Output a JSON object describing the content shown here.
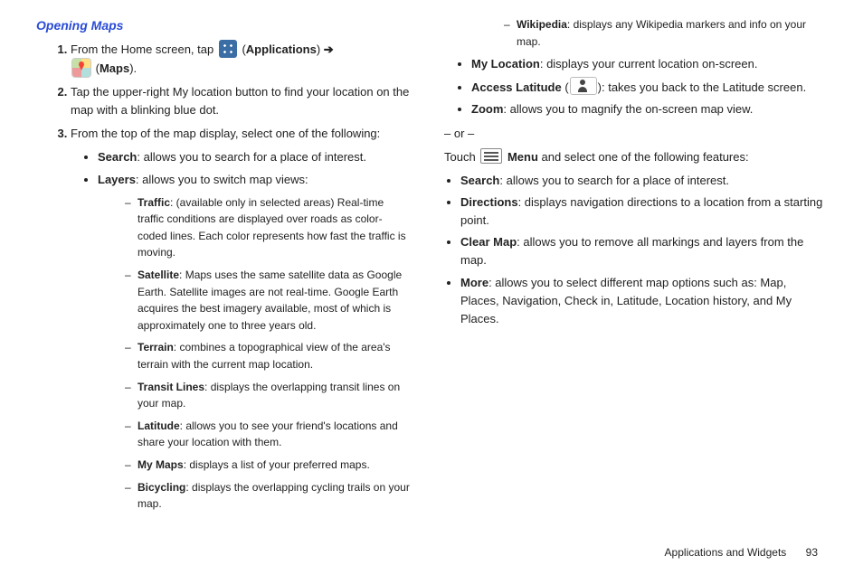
{
  "section_title": "Opening Maps",
  "step1": {
    "pre": "From the Home screen, tap ",
    "apps_label": "Applications",
    "arrow": "➔",
    "maps_label": "Maps",
    "end": "."
  },
  "step2": "Tap the upper-right My location button to find your location on the map with a blinking blue dot.",
  "step3_lead": "From the top of the map display, select one of the following:",
  "b1": {
    "term": "Search",
    "desc": ": allows you to search for a place of interest."
  },
  "b2": {
    "term": "Layers",
    "desc": ": allows you to switch map views:"
  },
  "d1": {
    "term": "Traffic",
    "desc": ": (available only in selected areas) Real-time traffic conditions are displayed over roads as color-coded lines. Each color represents how fast the traffic is moving."
  },
  "d2": {
    "term": "Satellite",
    "desc": ": Maps uses the same satellite data as Google Earth. Satellite images are not real-time. Google Earth acquires the best imagery available, most of which is approximately one to three years old."
  },
  "d3": {
    "term": "Terrain",
    "desc": ": combines a topographical view of the area's terrain with the current map location."
  },
  "d4": {
    "term": "Transit Lines",
    "desc": ": displays the overlapping transit lines on your map."
  },
  "d5": {
    "term": "Latitude",
    "desc": ": allows you to see your friend's locations and share your location with them."
  },
  "d6": {
    "term": "My Maps",
    "desc": ": displays a list of your preferred maps."
  },
  "d7": {
    "term": "Bicycling",
    "desc": ": displays the overlapping cycling trails on your map."
  },
  "d8": {
    "term": "Wikipedia",
    "desc": ": displays any Wikipedia markers and info on your map."
  },
  "r_b1": {
    "term": "My Location",
    "desc": ": displays your current location on-screen."
  },
  "r_b2": {
    "term": "Access Latitude",
    "desc": "): takes you back to the Latitude screen.",
    "open": " ("
  },
  "r_b3": {
    "term": "Zoom",
    "desc": ": allows you to magnify the on-screen map view."
  },
  "or_text": "– or –",
  "touch_text_pre": "Touch ",
  "menu_label": "Menu",
  "touch_text_post": " and select one of the following features:",
  "r_c1": {
    "term": "Search",
    "desc": ": allows you to search for a place of interest."
  },
  "r_c2": {
    "term": "Directions",
    "desc": ": displays navigation directions to a location from a starting point."
  },
  "r_c3": {
    "term": "Clear Map",
    "desc": ": allows you to remove all markings and layers from the map."
  },
  "r_c4": {
    "term": "More",
    "desc": ": allows you to select different map options such as: Map, Places, Navigation, Check in, Latitude, Location history, and My Places."
  },
  "footer": {
    "section": "Applications and Widgets",
    "page": "93"
  }
}
